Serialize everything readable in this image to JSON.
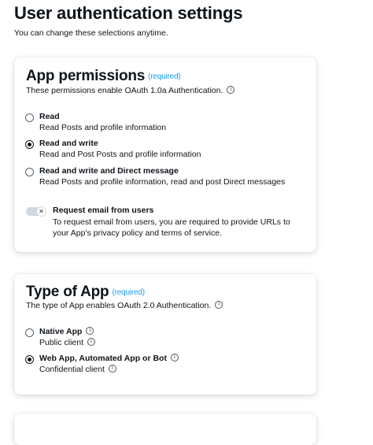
{
  "header": {
    "title": "User authentication settings",
    "subtitle": "You can change these selections anytime."
  },
  "app_permissions": {
    "title": "App permissions",
    "required": "(required)",
    "description": "These permissions enable OAuth 1.0a Authentication.",
    "options": [
      {
        "label": "Read",
        "description": "Read Posts and profile information",
        "selected": false
      },
      {
        "label": "Read and write",
        "description": "Read and Post Posts and profile information",
        "selected": true
      },
      {
        "label": "Read and write and Direct message",
        "description": "Read Posts and profile information, read and post Direct messages",
        "selected": false
      }
    ],
    "email_toggle": {
      "label": "Request email from users",
      "description": "To request email from users, you are required to provide URLs to your App's privacy policy and terms of service.",
      "enabled": false,
      "knob_glyph": "✕"
    }
  },
  "type_of_app": {
    "title": "Type of App",
    "required": "(required)",
    "description": "The type of App enables OAuth 2.0 Authentication.",
    "options": [
      {
        "label": "Native App",
        "description": "Public client",
        "selected": false
      },
      {
        "label": "Web App, Automated App or Bot",
        "description": "Confidential client",
        "selected": true
      }
    ]
  },
  "icons": {
    "info": "i"
  },
  "colors": {
    "accent": "#1d9bf0",
    "text": "#0f1419",
    "toggle_off": "#cfd9de"
  }
}
